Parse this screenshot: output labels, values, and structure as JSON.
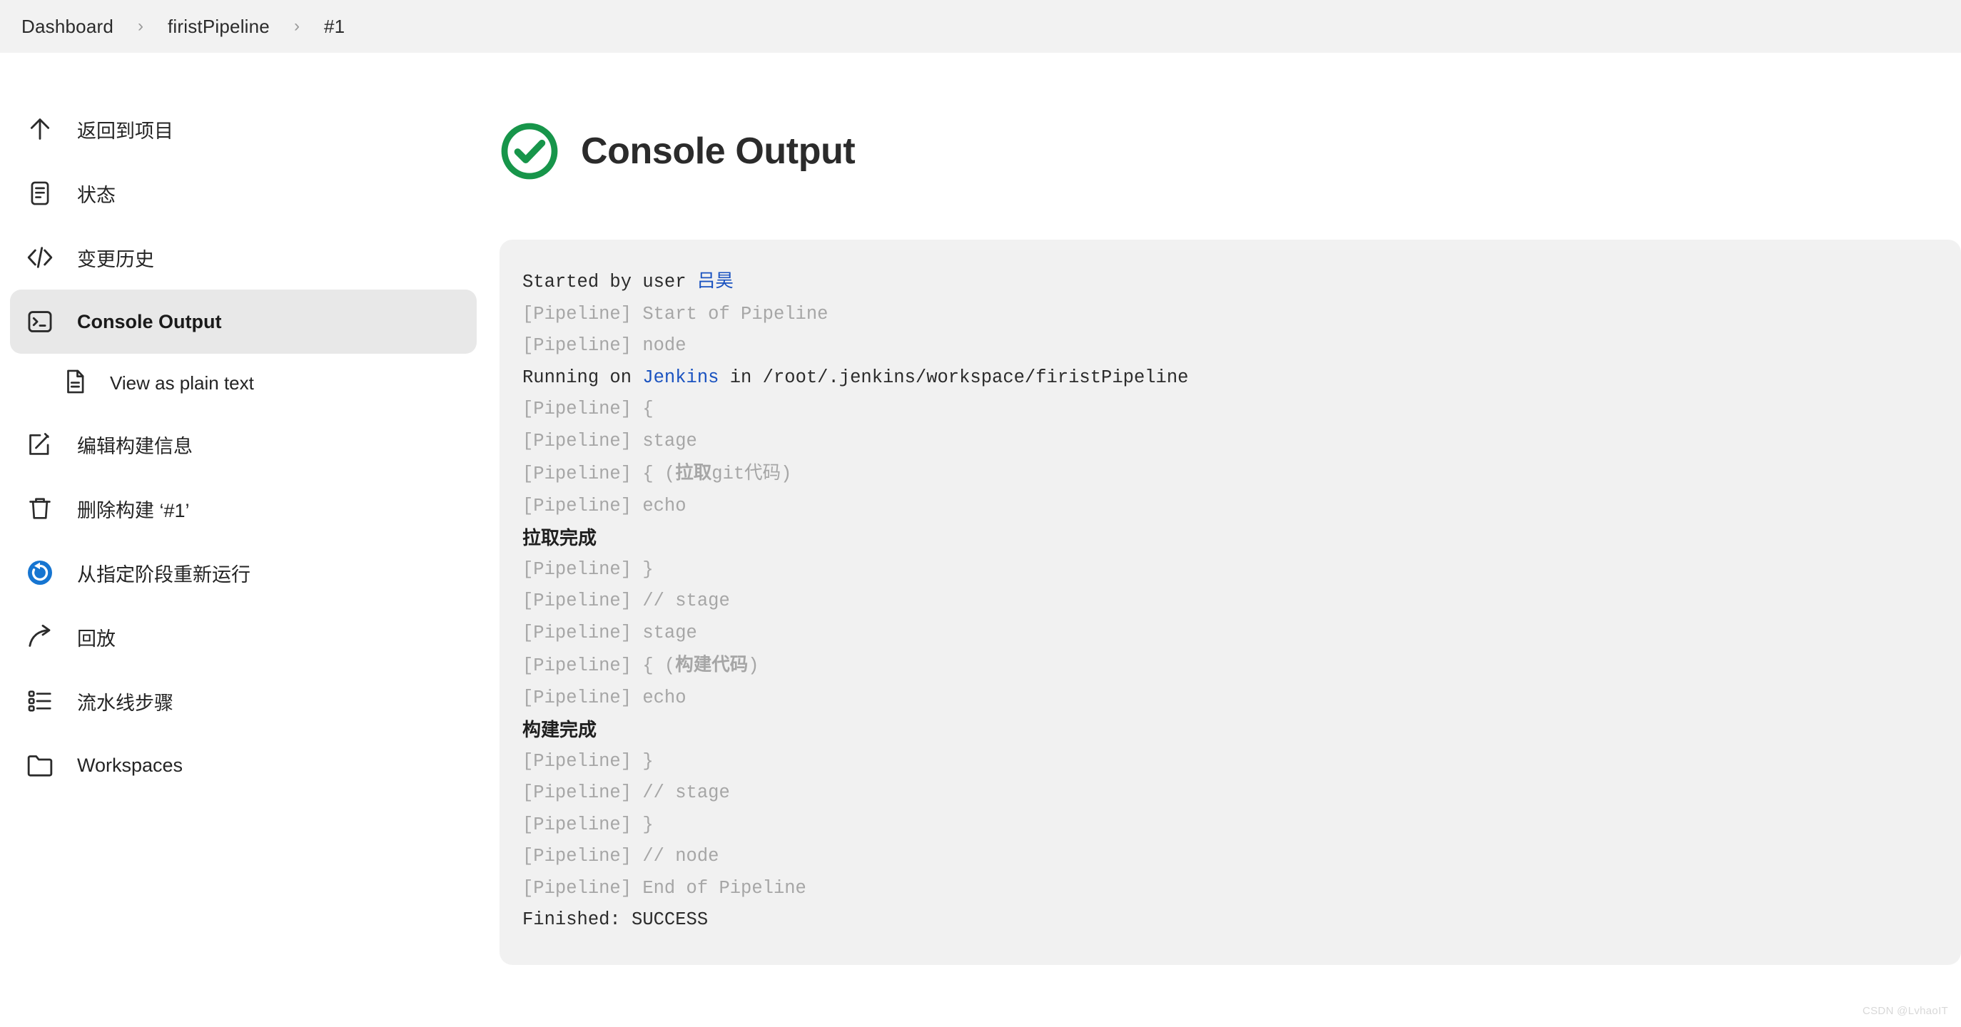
{
  "breadcrumb": {
    "items": [
      {
        "label": "Dashboard"
      },
      {
        "label": "firistPipeline"
      },
      {
        "label": "#1"
      }
    ],
    "separator": "›"
  },
  "sidebar": {
    "items": [
      {
        "label": "返回到项目",
        "icon": "arrow-up-icon",
        "active": false
      },
      {
        "label": "状态",
        "icon": "document-icon",
        "active": false
      },
      {
        "label": "变更历史",
        "icon": "code-icon",
        "active": false
      },
      {
        "label": "Console Output",
        "icon": "terminal-icon",
        "active": true
      },
      {
        "label": "编辑构建信息",
        "icon": "edit-icon",
        "active": false
      },
      {
        "label": "删除构建 ‘#1’",
        "icon": "trash-icon",
        "active": false
      },
      {
        "label": "从指定阶段重新运行",
        "icon": "restart-icon",
        "active": false
      },
      {
        "label": "回放",
        "icon": "replay-icon",
        "active": false
      },
      {
        "label": "流水线步骤",
        "icon": "steps-icon",
        "active": false
      },
      {
        "label": "Workspaces",
        "icon": "folder-icon",
        "active": false
      }
    ],
    "sub_item": {
      "label": "View as plain text",
      "icon": "plain-text-icon",
      "parent": "Console Output"
    }
  },
  "main": {
    "title": "Console Output",
    "status": "success",
    "status_color": "#17954a"
  },
  "console": {
    "lines": [
      {
        "segments": [
          {
            "text": "Started by user ",
            "style": "normal"
          },
          {
            "text": "吕昊",
            "style": "link"
          }
        ]
      },
      {
        "segments": [
          {
            "text": "[Pipeline] Start of Pipeline",
            "style": "muted"
          }
        ]
      },
      {
        "segments": [
          {
            "text": "[Pipeline] node",
            "style": "muted"
          }
        ]
      },
      {
        "segments": [
          {
            "text": "Running on ",
            "style": "normal"
          },
          {
            "text": "Jenkins",
            "style": "link"
          },
          {
            "text": " in /root/.jenkins/workspace/firistPipeline",
            "style": "normal"
          }
        ]
      },
      {
        "segments": [
          {
            "text": "[Pipeline] {",
            "style": "muted"
          }
        ]
      },
      {
        "segments": [
          {
            "text": "[Pipeline] stage",
            "style": "muted"
          }
        ]
      },
      {
        "segments": [
          {
            "text": "[Pipeline] { (",
            "style": "muted"
          },
          {
            "text": "拉取",
            "style": "muted-cn"
          },
          {
            "text": "git代码)",
            "style": "muted"
          }
        ]
      },
      {
        "segments": [
          {
            "text": "[Pipeline] echo",
            "style": "muted"
          }
        ]
      },
      {
        "segments": [
          {
            "text": "拉取完成",
            "style": "bold-cn"
          }
        ]
      },
      {
        "segments": [
          {
            "text": "[Pipeline] }",
            "style": "muted"
          }
        ]
      },
      {
        "segments": [
          {
            "text": "[Pipeline] // stage",
            "style": "muted"
          }
        ]
      },
      {
        "segments": [
          {
            "text": "[Pipeline] stage",
            "style": "muted"
          }
        ]
      },
      {
        "segments": [
          {
            "text": "[Pipeline] { (",
            "style": "muted"
          },
          {
            "text": "构建代码",
            "style": "muted-cn"
          },
          {
            "text": ")",
            "style": "muted"
          }
        ]
      },
      {
        "segments": [
          {
            "text": "[Pipeline] echo",
            "style": "muted"
          }
        ]
      },
      {
        "segments": [
          {
            "text": "构建完成",
            "style": "bold-cn"
          }
        ]
      },
      {
        "segments": [
          {
            "text": "[Pipeline] }",
            "style": "muted"
          }
        ]
      },
      {
        "segments": [
          {
            "text": "[Pipeline] // stage",
            "style": "muted"
          }
        ]
      },
      {
        "segments": [
          {
            "text": "[Pipeline] }",
            "style": "muted"
          }
        ]
      },
      {
        "segments": [
          {
            "text": "[Pipeline] // node",
            "style": "muted"
          }
        ]
      },
      {
        "segments": [
          {
            "text": "[Pipeline] End of Pipeline",
            "style": "muted"
          }
        ]
      },
      {
        "segments": [
          {
            "text": "Finished: SUCCESS",
            "style": "normal"
          }
        ]
      }
    ]
  },
  "watermark": {
    "text": "CSDN @LvhaoIT"
  },
  "colors": {
    "link": "#1b53c0",
    "muted": "#a6a6a6",
    "text": "#2b2b2b",
    "success": "#17954a",
    "panel_bg": "#f1f1f1",
    "active_bg": "#e8e8e8",
    "breadcrumb_bg": "#f2f2f2"
  }
}
